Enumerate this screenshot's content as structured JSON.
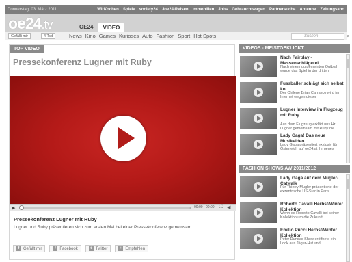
{
  "topbar": {
    "date": "Donnerstag, 03. März 2011",
    "links": [
      "WirKochen",
      "Spiele",
      "society24",
      "Joe24-Reisen",
      "Immobilien",
      "Jobs",
      "Gebrauchtwagen",
      "Partnersuche",
      "Antenne",
      "Zeitungsabo"
    ]
  },
  "header": {
    "logo_main": "oe24",
    "logo_suffix": ".tv",
    "tabs": [
      {
        "label": "OE24",
        "active": false
      },
      {
        "label": "VIDEO",
        "active": true
      }
    ]
  },
  "subnav": {
    "like_label": "Gefällt mir",
    "like_count": "4 Tsd",
    "categories": [
      "News",
      "Kino",
      "Games",
      "Kurioses",
      "Auto",
      "Fashion",
      "Sport",
      "Hot Spots"
    ],
    "search_placeholder": "Suchen"
  },
  "main": {
    "section_label": "TOP VIDEO",
    "video_title": "Pressekonferenz Lugner mit Ruby",
    "player": {
      "time_current": "00:00",
      "time_total": "00:00"
    },
    "desc_title": "Pressekonferenz Lugner mit Ruby",
    "desc_text": "Lugner und Ruby präsentieren sich zum ersten Mal bei einer Pressekonferenz gemeinsam",
    "share": [
      {
        "icon": "facebook-like-icon",
        "glyph": "f",
        "label": "Gefällt mir"
      },
      {
        "icon": "facebook-icon",
        "glyph": "f",
        "label": "Facebook"
      },
      {
        "icon": "twitter-icon",
        "glyph": "t",
        "label": "Twitter"
      },
      {
        "icon": "recommend-icon",
        "glyph": "+",
        "label": "Empfehlen"
      }
    ]
  },
  "sidebar": {
    "videos_heading": "VIDEOS - MEISTGEKLICKT",
    "videos": [
      {
        "title": "Nach Fairplay - Massenschlägerei",
        "text": "Nach einem gutgemeinten Outball wurde das Spiel in der dritten"
      },
      {
        "title": "Fussballer schlägt sich selbst ko.",
        "text": "Der Chilene Brian Carrasco wird im Internet wegen dieser"
      },
      {
        "title": "Lugner Interview im Flugzeug mit Ruby",
        "text": "Aus dem Flugzeug erklärt uns Hr. Lugner gemeinsam mit Ruby die"
      },
      {
        "title": "Lady Gaga! Das neue Musikvideo",
        "text": "Lady Gaga präsentiert exklusiv für Österreich auf oe24.at ihr neues"
      }
    ],
    "fashion_heading": "FASHION SHOWS AW 2011/2012",
    "fashion": [
      {
        "title": "Lady Gaga auf dem Mugler-Catwalk",
        "text": "Für Thierry Mugler präsentierte der exzentrische US-Star in Paris"
      },
      {
        "title": "Roberto Cavalli Herbst/Winter Kollektion",
        "text": "Wenn es Roberto Cavalli bei seiner Kollektion um die Zukunft"
      },
      {
        "title": "Emilio Pucci Herbst/Winter Kollektion",
        "text": "Peter Dundas Show eröffnete ein Look aus Jäger-Hut und"
      }
    ]
  }
}
